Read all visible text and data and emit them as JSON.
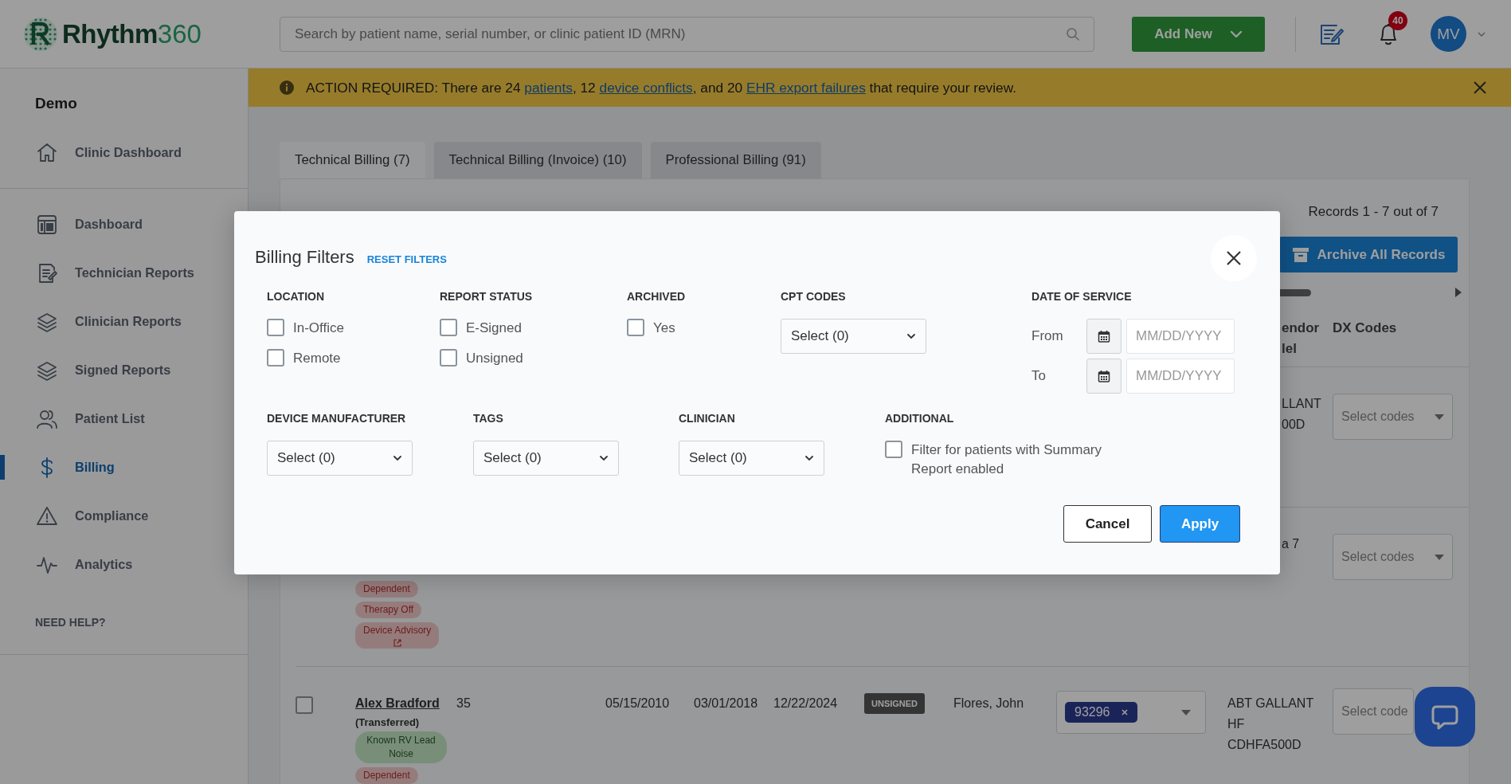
{
  "header": {
    "logo_word": "Rhythm",
    "logo_number": "360",
    "search_placeholder": "Search by patient name, serial number, or clinic patient ID (MRN)",
    "add_button": "Add New",
    "notification_count": "40",
    "avatar_initials": "MV"
  },
  "sidebar": {
    "clinic": "Demo",
    "top_items": [
      {
        "label": "Clinic Dashboard",
        "selected": false
      }
    ],
    "items": [
      {
        "label": "Dashboard",
        "selected": false
      },
      {
        "label": "Technician Reports",
        "selected": false
      },
      {
        "label": "Clinician Reports",
        "selected": false
      },
      {
        "label": "Signed Reports",
        "selected": false
      },
      {
        "label": "Patient List",
        "selected": false
      },
      {
        "label": "Billing",
        "selected": true
      },
      {
        "label": "Compliance",
        "selected": false
      },
      {
        "label": "Analytics",
        "selected": false
      }
    ],
    "help": "NEED HELP?"
  },
  "banner": {
    "segments": [
      {
        "kind": "text",
        "text": "ACTION REQUIRED: There are 24 "
      },
      {
        "kind": "link",
        "text": "patients"
      },
      {
        "kind": "text",
        "text": ", 12 "
      },
      {
        "kind": "link",
        "text": "device conflicts"
      },
      {
        "kind": "text",
        "text": ", and 20 "
      },
      {
        "kind": "link",
        "text": "EHR export failures"
      },
      {
        "kind": "text",
        "text": " that require your review."
      }
    ]
  },
  "tabs": [
    {
      "label": "Technical Billing (7)",
      "selected": true
    },
    {
      "label": "Technical Billing (Invoice) (10)",
      "selected": false
    },
    {
      "label": "Professional Billing (91)",
      "selected": false
    }
  ],
  "records": {
    "summary": "Records 1 - 7 out of 7",
    "archive_button": "Archive All Records"
  },
  "table": {
    "column_10": [
      "endor",
      "lel"
    ],
    "dx_codes": "DX Codes",
    "rows": [
      {
        "kind": "partial",
        "model_lines": [
          "LLANT",
          "00D"
        ],
        "dx_placeholder": "Select codes"
      },
      {
        "kind": "partial",
        "model_lines": [
          "a 7"
        ],
        "dx_placeholder": "Select codes",
        "tags": [
          {
            "label": "Dependent",
            "kind": "alert",
            "link": false
          },
          {
            "label": "Therapy Off",
            "kind": "alert",
            "link": false
          },
          {
            "label": "Device Advisory",
            "kind": "alert",
            "link": true
          }
        ]
      },
      {
        "kind": "full",
        "checked": false,
        "name": "Alex Bradford",
        "note": "(Transferred)",
        "age": "35",
        "dates": [
          "05/15/2010",
          "03/01/2018",
          "12/22/2024"
        ],
        "status": "UNSIGNED",
        "clinician": "Flores, John",
        "cpt_codes": [
          "93296"
        ],
        "model_lines": [
          "ABT GALLANT",
          "HF",
          "CDHFA500D"
        ],
        "dx_placeholder": "Select code",
        "tags": [
          {
            "label": "Known RV Lead Noise",
            "kind": "info",
            "link": false
          },
          {
            "label": "Dependent",
            "kind": "alert",
            "link": false
          }
        ]
      }
    ]
  },
  "modal": {
    "title": "Billing Filters",
    "reset": "RESET FILTERS",
    "filter_rows": [
      [
        {
          "kind": "checks",
          "label": "LOCATION",
          "options": [
            {
              "label": "In-Office",
              "checked": false
            },
            {
              "label": "Remote",
              "checked": false
            }
          ]
        },
        {
          "kind": "checks",
          "label": "REPORT STATUS",
          "options": [
            {
              "label": "E-Signed",
              "checked": false
            },
            {
              "label": "Unsigned",
              "checked": false
            }
          ]
        },
        {
          "kind": "checks",
          "label": "ARCHIVED",
          "options": [
            {
              "label": "Yes",
              "checked": false
            }
          ]
        },
        {
          "kind": "select",
          "label": "CPT CODES",
          "value": "Select (0)"
        },
        {
          "kind": "dates",
          "label": "DATE OF SERVICE",
          "fields": [
            {
              "label": "From",
              "placeholder": "MM/DD/YYYY"
            },
            {
              "label": "To",
              "placeholder": "MM/DD/YYYY"
            }
          ]
        }
      ],
      [
        {
          "kind": "select",
          "label": "DEVICE MANUFACTURER",
          "value": "Select (0)"
        },
        {
          "kind": "select",
          "label": "TAGS",
          "value": "Select (0)"
        },
        {
          "kind": "select",
          "label": "CLINICIAN",
          "value": "Select (0)"
        },
        {
          "kind": "checks",
          "label": "ADDITIONAL",
          "options": [
            {
              "label": "Filter for patients with Summary Report enabled",
              "checked": false
            }
          ]
        }
      ]
    ],
    "cancel": "Cancel",
    "apply": "Apply"
  }
}
